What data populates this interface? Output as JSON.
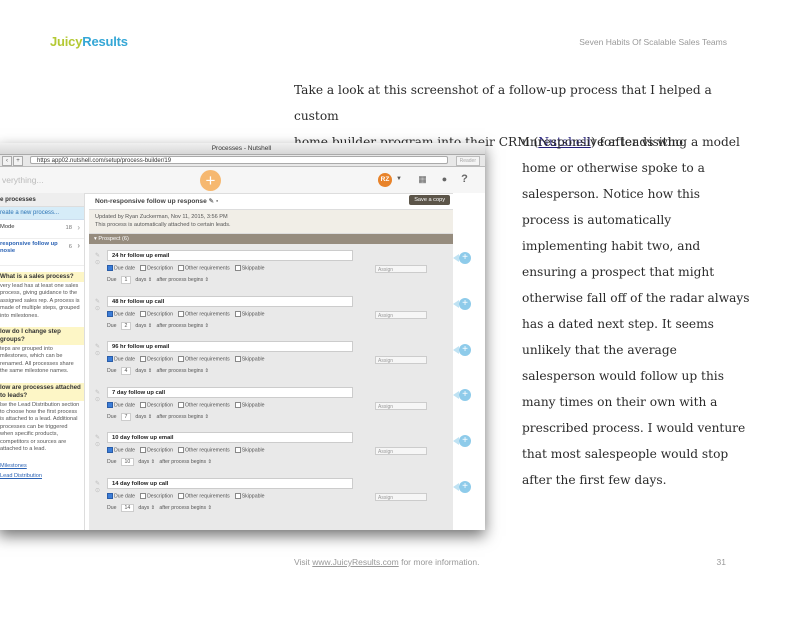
{
  "header": {
    "logo_part1": "Juicy",
    "logo_part2": "Results",
    "book_title": "Seven Habits Of Scalable Sales Teams"
  },
  "body_lines_wide": [
    "Take a look at this screenshot of a follow-up process that I helped a custom",
    "home builder program into their CRM ("
  ],
  "link_text": "Nutshell",
  "line2_tail": ") for leads who became",
  "body_lines_narrow": [
    "unresponsive after visiting a model",
    "home or otherwise spoke to a",
    "salesperson. Notice how this",
    "process is automatically",
    "implementing habit two, and",
    "ensuring a prospect that might",
    "otherwise fall off of the radar always",
    "has a dated next step. It seems",
    "unlikely that the average",
    "salesperson would follow up this",
    "many times on their own with a",
    "prescribed process. I would venture",
    "that most salespeople would stop",
    "after the first few days."
  ],
  "footer": {
    "prefix": "Visit ",
    "link": "www.JuicyResults.com",
    "suffix": " for more information.",
    "page": "31"
  },
  "screenshot": {
    "window_title": "Processes - Nutshell",
    "url": "https  app02.nutshell.com/setup/process-builder/19",
    "reader": "Reader",
    "search_placeholder": "verything...",
    "avatar": "RZ",
    "help": "?",
    "sidebar": {
      "heading": "e processes",
      "create": "reate a new process...",
      "items": [
        {
          "label": "Mode",
          "count": "18"
        },
        {
          "label": "responsive follow up\nnosie",
          "count": "6"
        }
      ],
      "faq": [
        {
          "q": "What is a sales process?",
          "a": "very lead has at least one sales process, giving guidance to the assigned sales rep. A process is made of multiple steps, grouped into milestones."
        },
        {
          "q": "low do I change step groups?",
          "a": "teps are grouped into milestones, which can be renamed. All processes share the same milestone names."
        },
        {
          "q": "low are processes attached to leads?",
          "a": "lse the Lead Distribution section to choose how the first process is attached to a lead. Additional processes can be triggered when specific products, competitors or sources are attached to a lead."
        }
      ],
      "links": [
        "Milestones",
        "Lead Distribution"
      ]
    },
    "main": {
      "title": "Non-responsive follow up response",
      "save_label": "Save a copy",
      "updated_line1": "Updated by Ryan Zuckerman, Nov 11, 2015, 3:56 PM",
      "updated_line2": "This process is automatically attached to certain leads.",
      "stage": "Prospect (6)",
      "check_labels": [
        "Due date",
        "Description",
        "Other requirements",
        "Skippable"
      ],
      "assign_label": "Assign",
      "due_label": "Due",
      "days_label": "days",
      "after_label": "after process begins",
      "steps": [
        {
          "name": "24 hr follow up email",
          "days": "1"
        },
        {
          "name": "48 hr follow up call",
          "days": "2"
        },
        {
          "name": "96 hr follow up email",
          "days": "4"
        },
        {
          "name": "7 day follow up call",
          "days": "7"
        },
        {
          "name": "10 day follow up email",
          "days": "10"
        },
        {
          "name": "14 day follow up call",
          "days": "14"
        }
      ]
    }
  }
}
